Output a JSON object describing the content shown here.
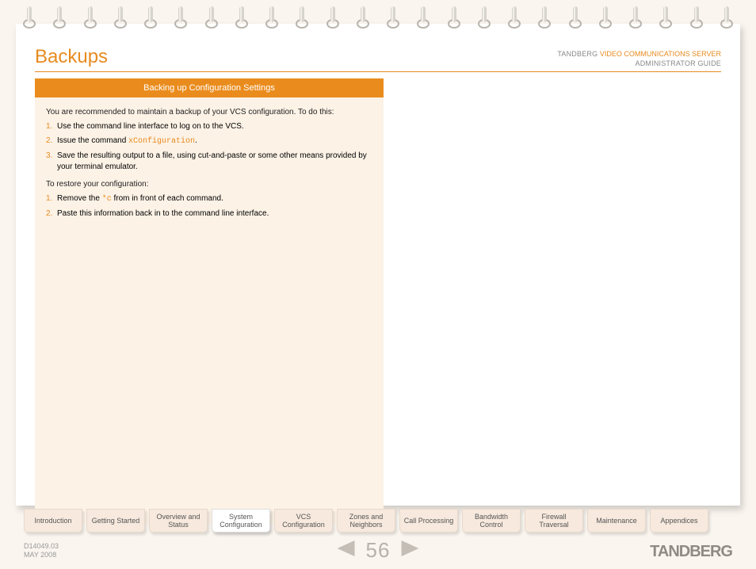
{
  "header": {
    "title": "Backups",
    "brand_prefix": "TANDBERG",
    "brand_highlight": "VIDEO COMMUNICATIONS SERVER",
    "brand_sub": "ADMINISTRATOR GUIDE"
  },
  "section": {
    "heading": "Backing up Configuration Settings",
    "intro": "You are recommended to maintain a backup of your VCS configuration. To do this:",
    "steps1": {
      "s1": "Use the command line interface to log on to the VCS.",
      "s2_pre": "Issue the command ",
      "s2_code": "xConfiguration",
      "s2_post": ".",
      "s3": "Save the resulting output to a file, using cut-and-paste or some other means provided by your terminal emulator."
    },
    "restore_intro": "To restore your configuration:",
    "steps2": {
      "s1_pre": "Remove the ",
      "s1_code": "*c",
      "s1_post": " from in front of each command.",
      "s2": "Paste this information back in to the command line interface."
    }
  },
  "tabs": [
    {
      "label": "Introduction"
    },
    {
      "label": "Getting Started"
    },
    {
      "label": "Overview and Status"
    },
    {
      "label": "System Configuration",
      "active": true
    },
    {
      "label": "VCS Configuration"
    },
    {
      "label": "Zones and Neighbors"
    },
    {
      "label": "Call Processing"
    },
    {
      "label": "Bandwidth Control"
    },
    {
      "label": "Firewall Traversal"
    },
    {
      "label": "Maintenance"
    },
    {
      "label": "Appendices"
    }
  ],
  "footer": {
    "doc_id": "D14049.03",
    "doc_date": "MAY 2008",
    "page_number": "56",
    "logo": "TANDBERG"
  }
}
